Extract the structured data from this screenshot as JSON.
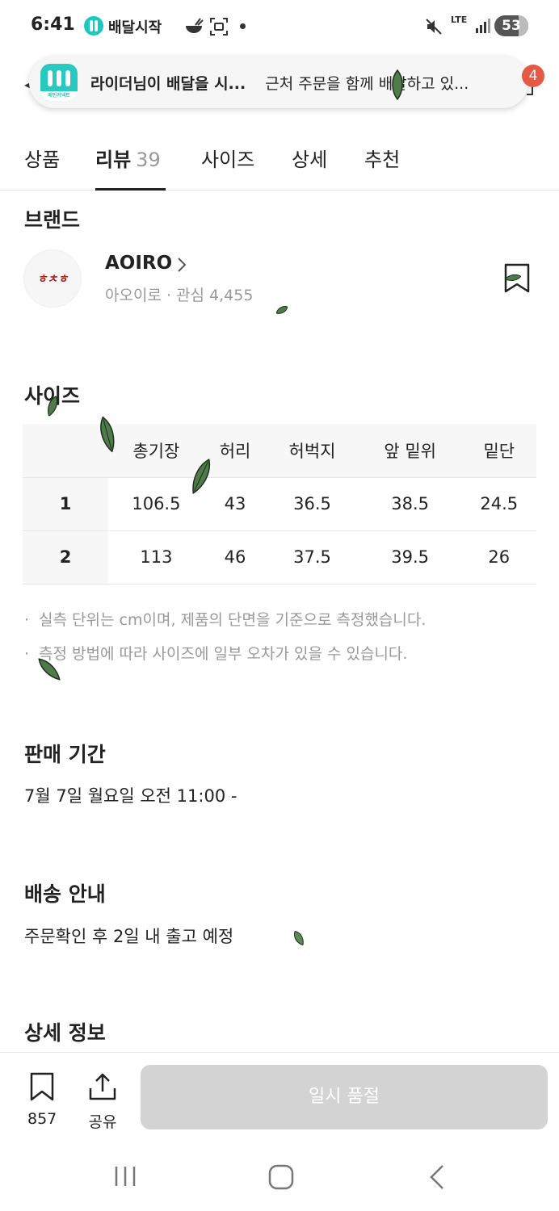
{
  "status_bar": {
    "time": "6:41",
    "app_label": "배달시작",
    "network": "LTE",
    "battery": "53"
  },
  "notification": {
    "app_icon_caption": "배민커넥트",
    "title": "라이더님이 배달을 시...",
    "body": "근처 주문을 함께 배달하고 있...",
    "badge": "4"
  },
  "tabs": [
    {
      "label": "상품"
    },
    {
      "label": "리뷰",
      "count": "39"
    },
    {
      "label": "사이즈"
    },
    {
      "label": "상세"
    },
    {
      "label": "추천"
    }
  ],
  "brand": {
    "section_title": "브랜드",
    "logo_text": "ㅎㅊㅎ",
    "name": "AOIRO",
    "meta": "아오이로 · 관심 4,455"
  },
  "size": {
    "section_title": "사이즈",
    "columns": [
      "총기장",
      "허리",
      "허벅지",
      "앞 밑위",
      "밑단"
    ],
    "rows": [
      {
        "label": "1",
        "values": [
          "106.5",
          "43",
          "36.5",
          "38.5",
          "24.5"
        ]
      },
      {
        "label": "2",
        "values": [
          "113",
          "46",
          "37.5",
          "39.5",
          "26"
        ]
      }
    ],
    "notes": [
      "실측 단위는 cm이며, 제품의 단면을 기준으로 측정했습니다.",
      "측정 방법에 따라 사이즈에 일부 오차가 있을 수 있습니다."
    ]
  },
  "sale_period": {
    "section_title": "판매 기간",
    "text": "7월 7일 월요일 오전 11:00 -"
  },
  "shipping": {
    "section_title": "배송 안내",
    "text": "주문확인 후 2일 내 출고 예정"
  },
  "detail": {
    "section_title": "상세 정보"
  },
  "bottom_bar": {
    "bookmark_count": "857",
    "share_label": "공유",
    "soldout_label": "일시 품절"
  },
  "colors": {
    "accent_teal": "#2ac9c0",
    "badge_red": "#e55a46",
    "leaf_green": "#4f7b4a",
    "disabled_button": "#d3d3d3"
  },
  "icons": {
    "bookmark": "bookmark-icon",
    "share": "share-icon",
    "chevron": "chevron-right-icon",
    "nav_recents": "recents-icon",
    "nav_home": "home-icon",
    "nav_back": "back-icon"
  }
}
